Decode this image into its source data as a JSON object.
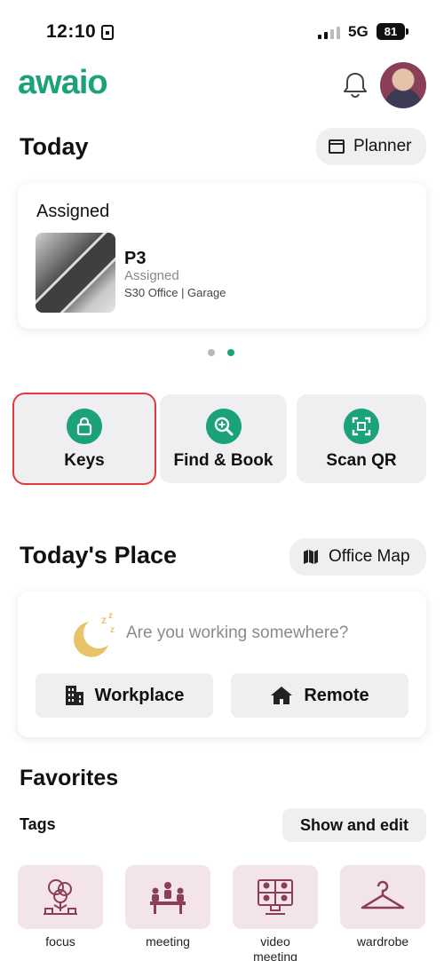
{
  "status_bar": {
    "time": "12:10",
    "network": "5G",
    "battery": "81"
  },
  "header": {
    "logo": "awaio"
  },
  "today": {
    "title": "Today",
    "planner_label": "Planner",
    "card": {
      "label": "Assigned",
      "spot": "P3",
      "status": "Assigned",
      "location": "S30 Office | Garage"
    },
    "page_indicator": {
      "count": 2,
      "active": 2
    }
  },
  "quick_actions": {
    "keys": "Keys",
    "find_book": "Find & Book",
    "scan_qr": "Scan QR"
  },
  "todays_place": {
    "title": "Today's Place",
    "office_map_label": "Office Map",
    "question": "Are you working somewhere?",
    "workplace": "Workplace",
    "remote": "Remote"
  },
  "favorites": {
    "title": "Favorites",
    "tags_label": "Tags",
    "show_edit": "Show and edit",
    "tags": [
      {
        "label": "focus",
        "icon": "tree-icon"
      },
      {
        "label": "meeting",
        "icon": "meeting-table-icon"
      },
      {
        "label": "video\nmeeting",
        "icon": "video-meeting-icon"
      },
      {
        "label": "wardrobe",
        "icon": "hanger-icon"
      }
    ]
  },
  "colors": {
    "brand": "#1aa37a",
    "highlight": "#e0393e",
    "tag_tile": "#f3e4e8",
    "tag_icon": "#8a3e57"
  }
}
